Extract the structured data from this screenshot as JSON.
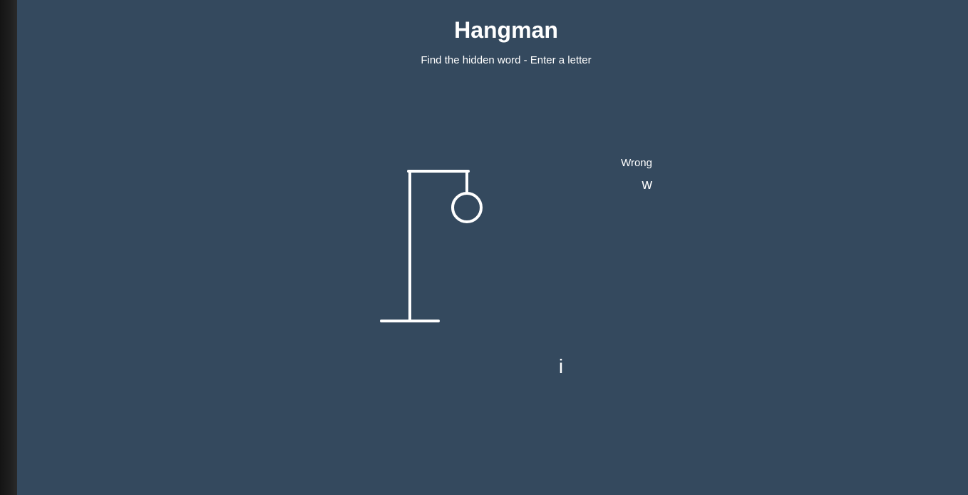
{
  "header": {
    "title": "Hangman",
    "subtitle": "Find the hidden word - Enter a letter"
  },
  "wrong": {
    "label": "Wrong",
    "letters": "w"
  },
  "word": {
    "letters": [
      "i"
    ]
  },
  "colors": {
    "background": "#34495e",
    "foreground": "#ffffff"
  },
  "figure": {
    "visible_parts": [
      "gallows-base",
      "gallows-pole",
      "gallows-beam",
      "gallows-rope",
      "head"
    ]
  }
}
